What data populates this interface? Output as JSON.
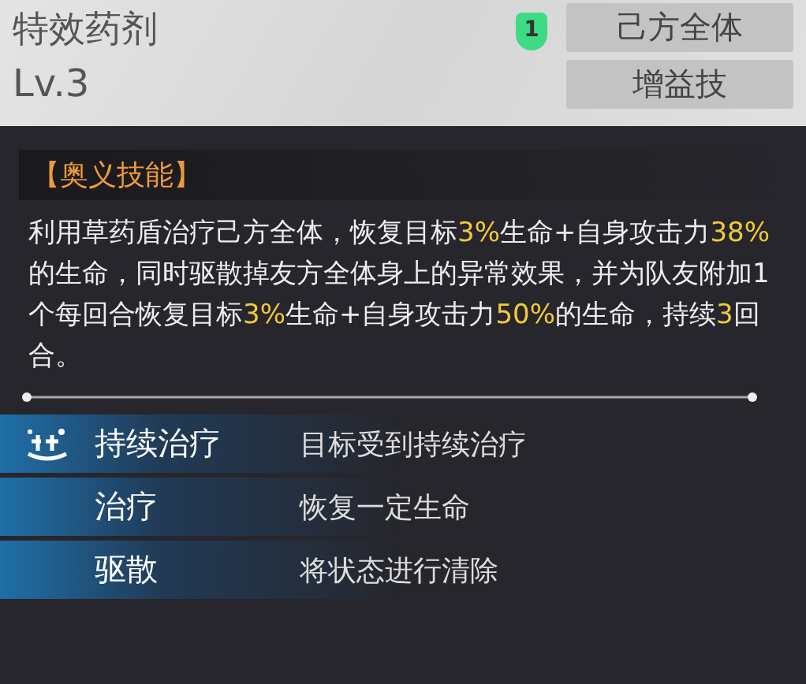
{
  "skill": {
    "name": "特效药剂",
    "level": "Lv.3",
    "badge": "1",
    "tags": [
      "己方全体",
      "增益技"
    ]
  },
  "section_title": "【奥义技能】",
  "description": "利用草药盾治疗己方全体，恢复目标**3%**生命+自身攻击力**38%**的生命，同时驱散掉友方全体身上的异常效果，并为队友附加1个每回合恢复目标**3%**生命+自身攻击力**50%**的生命，持续**3**回合。",
  "effects": [
    {
      "kind": "with-icon",
      "name": "持续治疗",
      "text": "目标受到持续治疗"
    },
    {
      "kind": "plain",
      "name": "治疗",
      "text": "恢复一定生命"
    },
    {
      "kind": "plain",
      "name": "驱散",
      "text": "将状态进行清除"
    }
  ]
}
